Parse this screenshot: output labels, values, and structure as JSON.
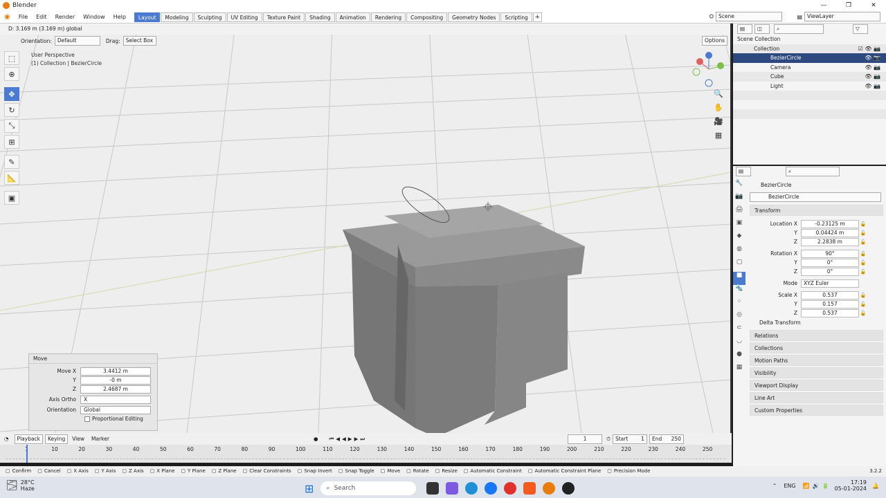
{
  "window": {
    "title": "Blender"
  },
  "menu": [
    "File",
    "Edit",
    "Render",
    "Window",
    "Help"
  ],
  "workspaces": [
    "Layout",
    "Modeling",
    "Sculpting",
    "UV Editing",
    "Texture Paint",
    "Shading",
    "Animation",
    "Rendering",
    "Compositing",
    "Geometry Nodes",
    "Scripting",
    "+"
  ],
  "scene": "Scene",
  "view_layer": "ViewLayer",
  "viewport": {
    "header_text": "D: 3.169 m (3.169 m) global",
    "orientation_label": "Orientation:",
    "orientation_value": "Default",
    "drag_label": "Drag:",
    "drag_value": "Select Box",
    "options": "Options",
    "perspective": "User Perspective",
    "collection_info": "(1) Collection | BezierCircle"
  },
  "move_panel": {
    "title": "Move",
    "move_x_label": "Move X",
    "move_x": "3.4412 m",
    "y_label": "Y",
    "y": "-0 m",
    "z_label": "Z",
    "z": "2.4687 m",
    "axis_ortho_label": "Axis Ortho",
    "axis_ortho": "X",
    "orientation_label": "Orientation",
    "orientation": "Global",
    "proportional": "Proportional Editing"
  },
  "outliner": {
    "scene_collection": "Scene Collection",
    "collection": "Collection",
    "items": [
      "BezierCircle",
      "Camera",
      "Cube",
      "Light"
    ]
  },
  "properties": {
    "object_name": "BezierCircle",
    "data_name": "BezierCircle",
    "transform_title": "Transform",
    "location_label": "Location X",
    "loc_x": "-0.23125 m",
    "loc_y": "0.04424 m",
    "loc_z": "2.2838 m",
    "rotation_label": "Rotation X",
    "rot_x": "90°",
    "rot_y": "0°",
    "rot_z": "0°",
    "mode_label": "Mode",
    "mode": "XYZ Euler",
    "scale_label": "Scale X",
    "scale_x": "0.537",
    "scale_y": "0.157",
    "scale_z": "0.537",
    "y": "Y",
    "z": "Z",
    "delta": "Delta Transform",
    "sections": [
      "Relations",
      "Collections",
      "Motion Paths",
      "Visibility",
      "Viewport Display",
      "Line Art",
      "Custom Properties"
    ]
  },
  "timeline": {
    "playback": "Playback",
    "keying": "Keying",
    "view": "View",
    "marker": "Marker",
    "current_frame": "1",
    "start_label": "Start",
    "start": "1",
    "end_label": "End",
    "end": "250",
    "ticks": [
      "1",
      "10",
      "20",
      "30",
      "40",
      "50",
      "60",
      "70",
      "80",
      "90",
      "100",
      "110",
      "120",
      "130",
      "140",
      "150",
      "160",
      "170",
      "180",
      "190",
      "200",
      "210",
      "220",
      "230",
      "240",
      "250"
    ]
  },
  "status_bar": [
    "Confirm",
    "Cancel",
    "X Axis",
    "Y Axis",
    "Z Axis",
    "X Plane",
    "Y Plane",
    "Z Plane",
    "Clear Constraints",
    "Snap Invert",
    "Snap Toggle",
    "Move",
    "Rotate",
    "Resize",
    "Automatic Constraint",
    "Automatic Constraint Plane",
    "Precision Mode"
  ],
  "version": "3.2.2",
  "taskbar": {
    "temp": "28°C",
    "weather": "Haze",
    "search": "Search",
    "lang": "ENG",
    "time": "17:19",
    "date": "05-01-2024"
  }
}
